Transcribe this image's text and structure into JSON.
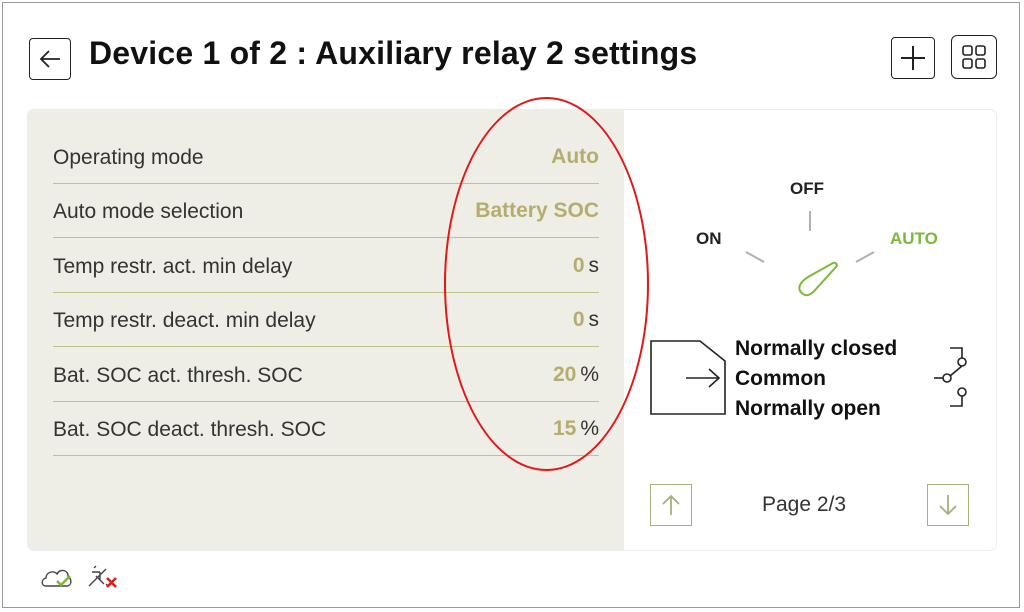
{
  "header": {
    "title": "Device 1 of 2 : Auxiliary relay 2 settings",
    "back_icon": "arrow-left-icon",
    "add_icon": "plus-icon",
    "grid_icon": "grid-view-icon"
  },
  "settings": [
    {
      "label": "Operating mode",
      "value": "Auto",
      "unit": ""
    },
    {
      "label": "Auto mode selection",
      "value": "Battery SOC",
      "unit": ""
    },
    {
      "label": "Temp restr. act. min delay",
      "value": "0",
      "unit": "s"
    },
    {
      "label": "Temp restr. deact. min delay",
      "value": "0",
      "unit": "s"
    },
    {
      "label": "Bat. SOC act. thresh. SOC",
      "value": "20",
      "unit": "%"
    },
    {
      "label": "Bat. SOC deact. thresh. SOC",
      "value": "15",
      "unit": "%"
    }
  ],
  "switch": {
    "on_label": "ON",
    "off_label": "OFF",
    "auto_label": "AUTO",
    "active": "AUTO"
  },
  "relay": {
    "nc_label": "Normally closed",
    "common_label": "Common",
    "no_label": "Normally open"
  },
  "pagination": {
    "text": "Page 2/3",
    "up_icon": "arrow-up-icon",
    "down_icon": "arrow-down-icon"
  },
  "status": {
    "cloud_icon": "cloud-connected-icon",
    "link_icon": "network-disconnected-icon"
  },
  "colors": {
    "accent_green": "#7cb83a",
    "value_olive": "#b5ad6f",
    "panel_bg": "#eeeee6",
    "annotation_red": "#e01818",
    "error_red": "#d42020"
  }
}
